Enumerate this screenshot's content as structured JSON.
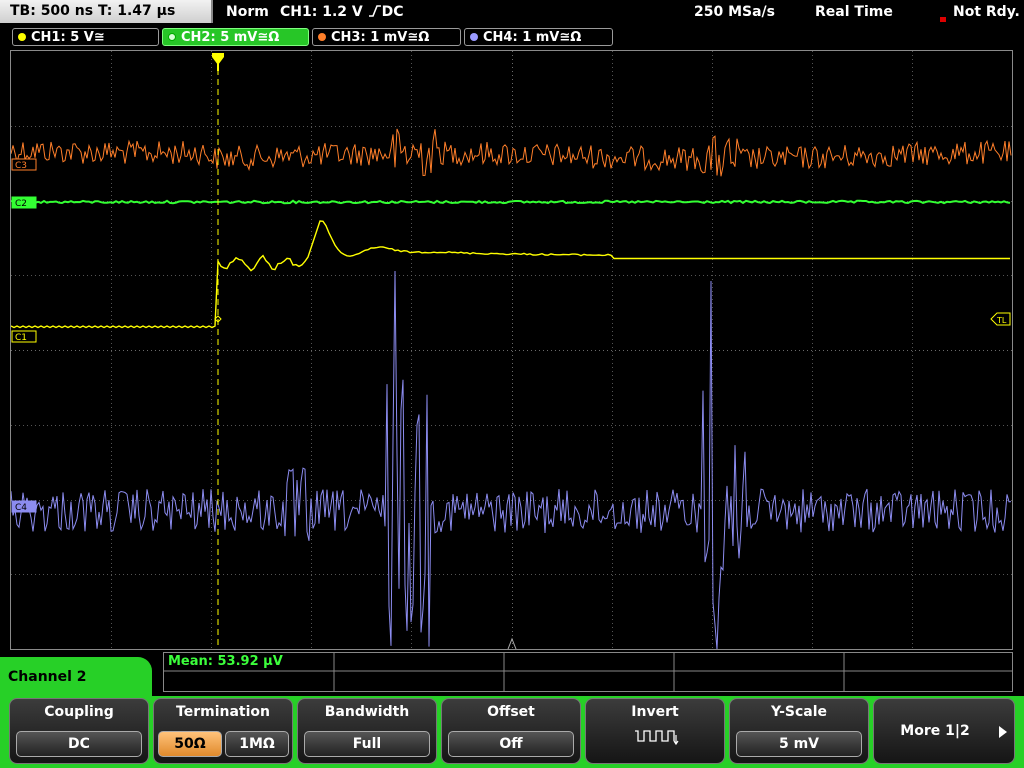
{
  "status": {
    "timebase": "TB: 500 ns   T: 1.47 µs",
    "mode": "Norm",
    "trigger": "CH1: 1.2 V ⎍ DC",
    "trigger_text": "CH1: 1.2 V",
    "trigger_coupling": "DC",
    "sample_rate": "250 MSa/s",
    "acq_mode": "Real Time",
    "ready": "Not Rdy."
  },
  "channels": [
    {
      "label": "CH1: 5 V≅",
      "color": "#ffff00"
    },
    {
      "label": "CH2: 5 mV≅Ω",
      "color": "#33ff33",
      "active": true
    },
    {
      "label": "CH3: 1 mV≅Ω",
      "color": "#ff7f2a"
    },
    {
      "label": "CH4: 1 mV≅Ω",
      "color": "#9a9aff"
    }
  ],
  "markers": {
    "c3": "C3",
    "c2": "C2",
    "c1": "C1",
    "c4": "C4",
    "tl": "TL"
  },
  "measurement": {
    "mean": "Mean: 53.92 µV"
  },
  "menu": {
    "title": "Channel 2",
    "coupling": {
      "title": "Coupling",
      "value": "DC"
    },
    "termination": {
      "title": "Termination",
      "opt1": "50Ω",
      "opt2": "1MΩ",
      "selected": "50Ω"
    },
    "bandwidth": {
      "title": "Bandwidth",
      "value": "Full"
    },
    "offset": {
      "title": "Offset",
      "value": "Off"
    },
    "invert": {
      "title": "Invert"
    },
    "yscale": {
      "title": "Y-Scale",
      "value": "5 mV"
    },
    "more": {
      "label": "More 1|2"
    }
  },
  "colors": {
    "ch1": "#ffff00",
    "ch2": "#33ff33",
    "ch3": "#ff7f2a",
    "ch4": "#9a9aff",
    "menu_accent": "#27d027",
    "selected_option": "#f0a050"
  }
}
